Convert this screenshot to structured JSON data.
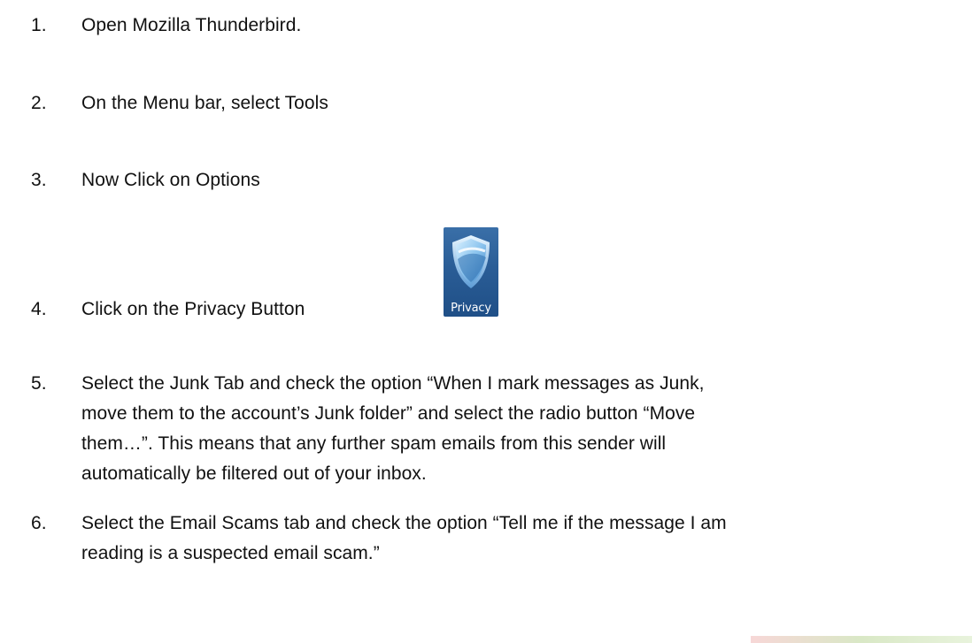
{
  "steps": [
    {
      "number": "1.",
      "lines": [
        "Open Mozilla Thunderbird."
      ]
    },
    {
      "number": "2.",
      "lines": [
        "On the Menu bar, select Tools"
      ]
    },
    {
      "number": "3.",
      "lines": [
        "Now Click on Options"
      ]
    },
    {
      "number": "4.",
      "lines": [
        "Click on the Privacy Button"
      ]
    },
    {
      "number": "5.",
      "lines": [
        "Select the Junk Tab and check the option “When I mark messages as Junk,",
        "move them to the account’s Junk folder” and select the radio button “Move",
        "them…”.  This means that any further spam emails from this sender will",
        "automatically be filtered out of your inbox."
      ]
    },
    {
      "number": "6.",
      "lines": [
        "Select the Email Scams tab and check the option “Tell me if the message I am",
        "reading is a suspected email scam.”"
      ]
    }
  ],
  "privacy_button": {
    "label": "Privacy",
    "icon": "shield-icon",
    "colors": {
      "background": "#2a5d96",
      "shield": "#9fd0f5"
    }
  }
}
